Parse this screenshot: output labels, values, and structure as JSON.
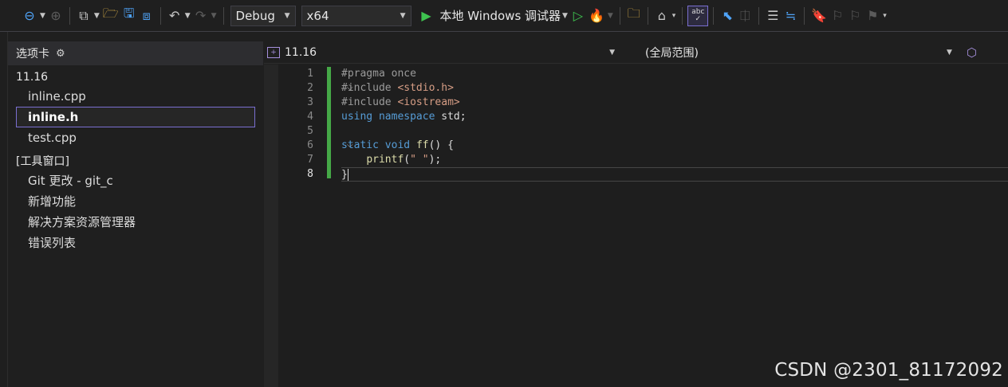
{
  "toolbar": {
    "config": "Debug",
    "platform": "x64",
    "run_label": "本地 Windows 调试器",
    "spell_label": "abc"
  },
  "tab_panel": {
    "title": "选项卡",
    "groups": [
      {
        "title": "11.16",
        "items": [
          {
            "label": "inline.cpp",
            "selected": false
          },
          {
            "label": "inline.h",
            "selected": true
          },
          {
            "label": "test.cpp",
            "selected": false
          }
        ]
      },
      {
        "title": "[工具窗口]",
        "items": [
          {
            "label": "Git 更改 - git_c",
            "selected": false
          },
          {
            "label": "新增功能",
            "selected": false
          },
          {
            "label": "解决方案资源管理器",
            "selected": false
          },
          {
            "label": "错误列表",
            "selected": false
          }
        ]
      }
    ]
  },
  "editor": {
    "project_dropdown": "11.16",
    "scope_dropdown": "(全局范围)",
    "line_numbers": [
      "1",
      "2",
      "3",
      "4",
      "5",
      "6",
      "7",
      "8"
    ],
    "active_line": "8",
    "lines": [
      [
        {
          "t": "#pragma once",
          "c": "pre"
        }
      ],
      [
        {
          "t": "#include ",
          "c": "pre"
        },
        {
          "t": "<stdio.h>",
          "c": "inc"
        }
      ],
      [
        {
          "t": "#include ",
          "c": "pre"
        },
        {
          "t": "<iostream>",
          "c": "inc"
        }
      ],
      [
        {
          "t": "using ",
          "c": "kw"
        },
        {
          "t": "namespace ",
          "c": "kw"
        },
        {
          "t": "std;",
          "c": "txt"
        }
      ],
      [],
      [
        {
          "t": "static ",
          "c": "kw"
        },
        {
          "t": "void ",
          "c": "kw"
        },
        {
          "t": "ff",
          "c": "fn"
        },
        {
          "t": "() {",
          "c": "txt"
        }
      ],
      [
        {
          "t": "    ",
          "c": "txt"
        },
        {
          "t": "printf",
          "c": "fn"
        },
        {
          "t": "(",
          "c": "txt"
        },
        {
          "t": "\" \"",
          "c": "str"
        },
        {
          "t": ");",
          "c": "txt"
        }
      ],
      [
        {
          "t": "}",
          "c": "txt"
        }
      ]
    ]
  },
  "watermark": "CSDN @2301_81172092"
}
